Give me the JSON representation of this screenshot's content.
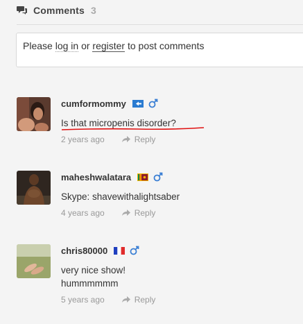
{
  "header": {
    "title": "Comments",
    "count": "3"
  },
  "login_prompt": {
    "prefix": "Please",
    "login_link": "log in",
    "middle": "or",
    "register_link": "register",
    "suffix": "to post comments"
  },
  "comments": [
    {
      "username": "cumformommy",
      "flag": "blue-flag",
      "gender": "male-icon",
      "text": "Is that micropenis disorder?",
      "time": "2 years ago",
      "reply_label": "Reply"
    },
    {
      "username": "maheshwalatara",
      "flag": "sri-lanka-flag",
      "gender": "male-icon",
      "text": "Skype: shavewithalightsaber",
      "time": "4 years ago",
      "reply_label": "Reply"
    },
    {
      "username": "chris80000",
      "flag": "france-flag",
      "gender": "male-icon",
      "text_line1": "very nice show!",
      "text_line2": "hummmmmm",
      "time": "5 years ago",
      "reply_label": "Reply"
    }
  ],
  "colors": {
    "male_icon": "#3b7fd4",
    "annotation_underline": "#e01010"
  }
}
